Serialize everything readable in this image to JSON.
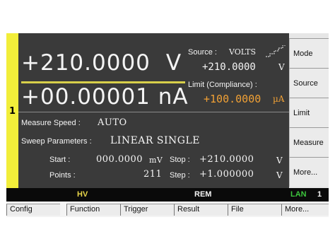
{
  "channel": "1",
  "display": {
    "source_value": "+210.0000",
    "source_unit": "V",
    "measured_value": "+00.00001 nA"
  },
  "source": {
    "label": "Source :",
    "mode": "VOLTS",
    "mode_icon": "staircase-sweep-icon",
    "value": "+210.0000",
    "unit": "V"
  },
  "limit": {
    "label": "Limit (Compliance) :",
    "value": "+100.0000",
    "unit": "µA",
    "color": "#f0a035"
  },
  "measure_speed": {
    "label": "Measure Speed :",
    "value": "AUTO"
  },
  "sweep": {
    "label": "Sweep Parameters :",
    "value": "LINEAR SINGLE",
    "start_label": "Start :",
    "start_value": "000.0000",
    "start_unit": "mV",
    "stop_label": "Stop :",
    "stop_value": "+210.0000",
    "stop_unit": "V",
    "points_label": "Points :",
    "points_value": "211",
    "step_label": "Step :",
    "step_value": "+1.000000",
    "step_unit": "V"
  },
  "softkeys": [
    "Mode",
    "Source",
    "Limit",
    "Measure",
    "More..."
  ],
  "status_bar": {
    "hv": "HV",
    "hv_color": "#e8d64a",
    "rem": "REM",
    "lan": "LAN",
    "lan_color": "#3cc43c",
    "lan_number": "1"
  },
  "function_keys": [
    "Config",
    "Function",
    "Trigger",
    "Result",
    "File",
    "More..."
  ],
  "colors": {
    "panel": "#3a3a3a",
    "accent_yellow": "#f2ee3a",
    "text": "#f4f4f4"
  }
}
